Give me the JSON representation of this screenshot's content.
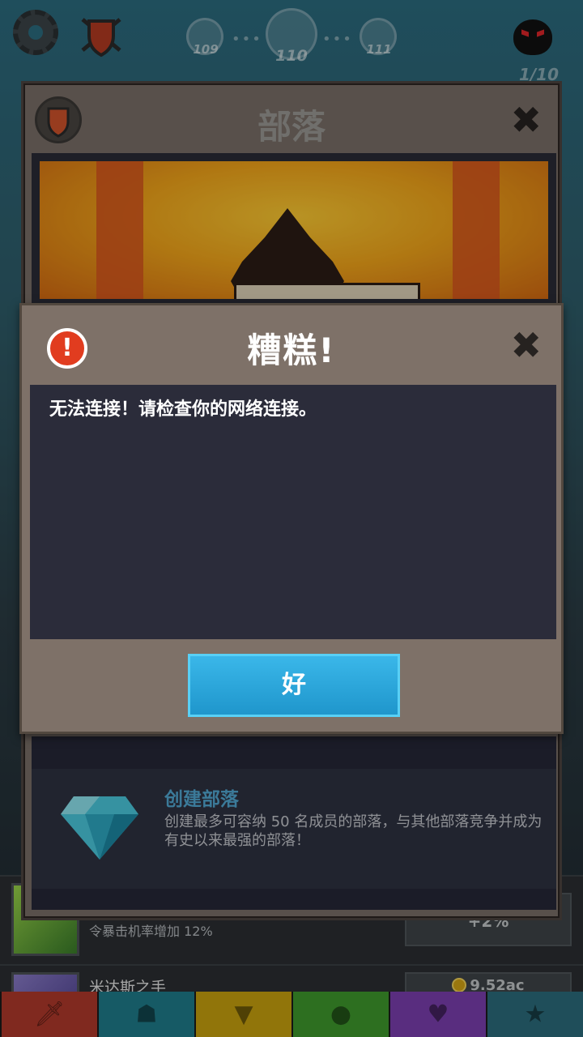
{
  "hud": {
    "stages": [
      "109",
      "110",
      "111"
    ],
    "boss_progress": "1/10"
  },
  "clan_window": {
    "title": "部落",
    "close_glyph": "✖",
    "create_clan": {
      "title": "创建部落",
      "description": "创建最多可容纳 50 名成员的部落，与其他部落竞争并成为有史以来最强的部落！"
    }
  },
  "background_list": {
    "row1_text": "令暴击机率增加 12%",
    "row1_button": "+2%",
    "row2_title": "米达斯之手",
    "row2_button": "9.52ac"
  },
  "dialog": {
    "icon_glyph": "!",
    "title": "糟糕!",
    "close_glyph": "✖",
    "message": "无法连接！请检查你的网络连接。",
    "ok_label": "好"
  },
  "tabbar": {
    "tabs": [
      {
        "icon": "sword-icon",
        "color": "#c0392b"
      },
      {
        "icon": "hero-icon",
        "color": "#1f7d8c"
      },
      {
        "icon": "shirt-icon",
        "color": "#c9a20f"
      },
      {
        "icon": "pet-icon",
        "color": "#3f9a2d"
      },
      {
        "icon": "artifact-icon",
        "color": "#7c3fb0"
      },
      {
        "icon": "shop-icon",
        "color": "#2b6d7d"
      }
    ]
  }
}
